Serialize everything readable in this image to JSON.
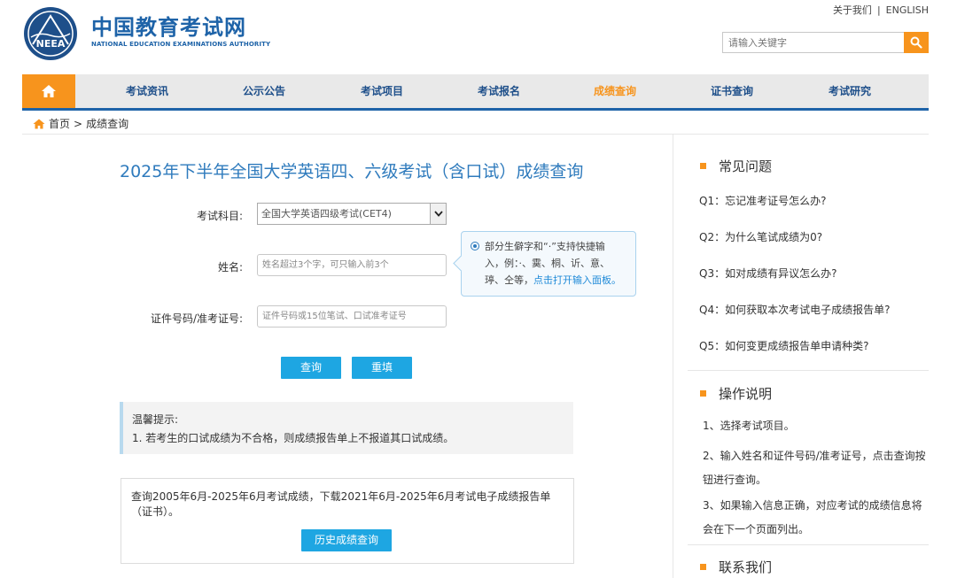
{
  "header": {
    "logo_text": "NEEA",
    "brand_cn": "中国教育考试网",
    "brand_en": "NATIONAL EDUCATION EXAMINATIONS AUTHORITY",
    "top_links": [
      "关于我们",
      "ENGLISH"
    ],
    "top_sep": "|",
    "search_placeholder": "请输入关键字"
  },
  "nav": {
    "items": [
      "考试资讯",
      "公示公告",
      "考试项目",
      "考试报名",
      "成绩查询",
      "证书查询",
      "考试研究"
    ],
    "active": "成绩查询",
    "accent": "#f7941d",
    "primary": "#1e63a8"
  },
  "breadcrumb": {
    "home": "首页",
    "sep": ">",
    "current": "成绩查询"
  },
  "main": {
    "title": "2025年下半年全国大学英语四、六级考试（含口试）成绩查询",
    "form": {
      "subject_label": "考试科目:",
      "subject_value": "全国大学英语四级考试(CET4)",
      "name_label": "姓名:",
      "name_placeholder": "姓名超过3个字，可只输入前3个",
      "id_label": "证件号码/准考证号:",
      "id_placeholder": "证件号码或15位笔试、口试准考证号"
    },
    "tip": {
      "line1": "部分生僻字和“·”支持快捷输",
      "line2": "入，例：·、霙、桐、䜣、意、",
      "line3_text": "𤧟、仝等，",
      "line3_link": "点击打开输入面板。"
    },
    "buttons": {
      "query": "查询",
      "reset": "重填"
    },
    "notice": {
      "title": "温馨提示:",
      "item1": "1. 若考生的口试成绩为不合格，则成绩报告单上不报道其口试成绩。"
    },
    "history": {
      "text": "查询2005年6月-2025年6月考试成绩，下载2021年6月-2025年6月考试电子成绩报告单（证书）。",
      "button": "历史成绩查询"
    }
  },
  "sidebar": {
    "faq_title": "常见问题",
    "faq": [
      "Q1：忘记准考证号怎么办?",
      "Q2：为什么笔试成绩为0?",
      "Q3：如对成绩有异议怎么办?",
      "Q4：如何获取本次考试电子成绩报告单?",
      "Q5：如何变更成绩报告单申请种类?"
    ],
    "ops_title": "操作说明",
    "ops": [
      "1、选择考试项目。",
      "2、输入姓名和证件号码/准考证号，点击查询按钮进行查询。",
      "3、如果输入信息正确，对应考试的成绩信息将会在下一个页面列出。"
    ],
    "contact_title": "联系我们"
  }
}
